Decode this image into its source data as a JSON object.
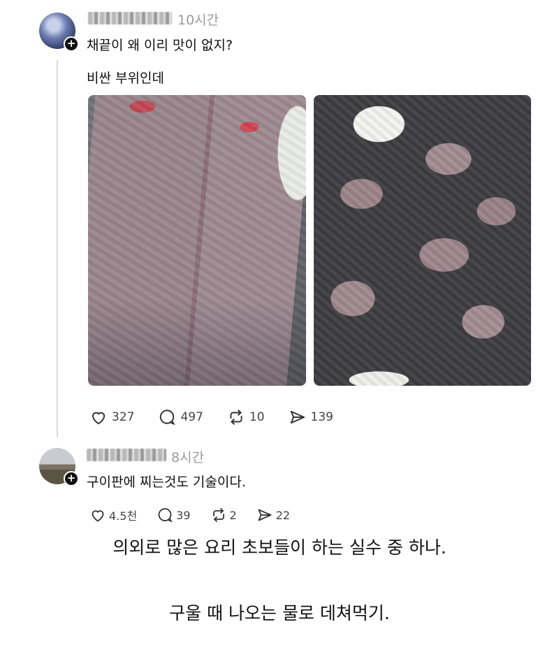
{
  "post": {
    "time": "10시간",
    "line1": "채끝이 왜 이리 맛이 없지?",
    "line2": "비싼 부위인데",
    "stats": {
      "likes": "327",
      "comments": "497",
      "reposts": "10",
      "shares": "139"
    }
  },
  "reply": {
    "time": "8시간",
    "text": "구이판에 찌는것도 기술이다.",
    "stats": {
      "likes": "4.5천",
      "comments": "39",
      "reposts": "2",
      "shares": "22"
    }
  },
  "caption": {
    "line1": "의외로 많은 요리 초보들이 하는 실수 중 하나.",
    "line2": "구울 때 나오는 물로 데쳐먹기."
  },
  "icons": {
    "follow": "plus-icon",
    "like": "heart-icon",
    "comment": "comment-icon",
    "repost": "repost-icon",
    "share": "send-icon"
  }
}
